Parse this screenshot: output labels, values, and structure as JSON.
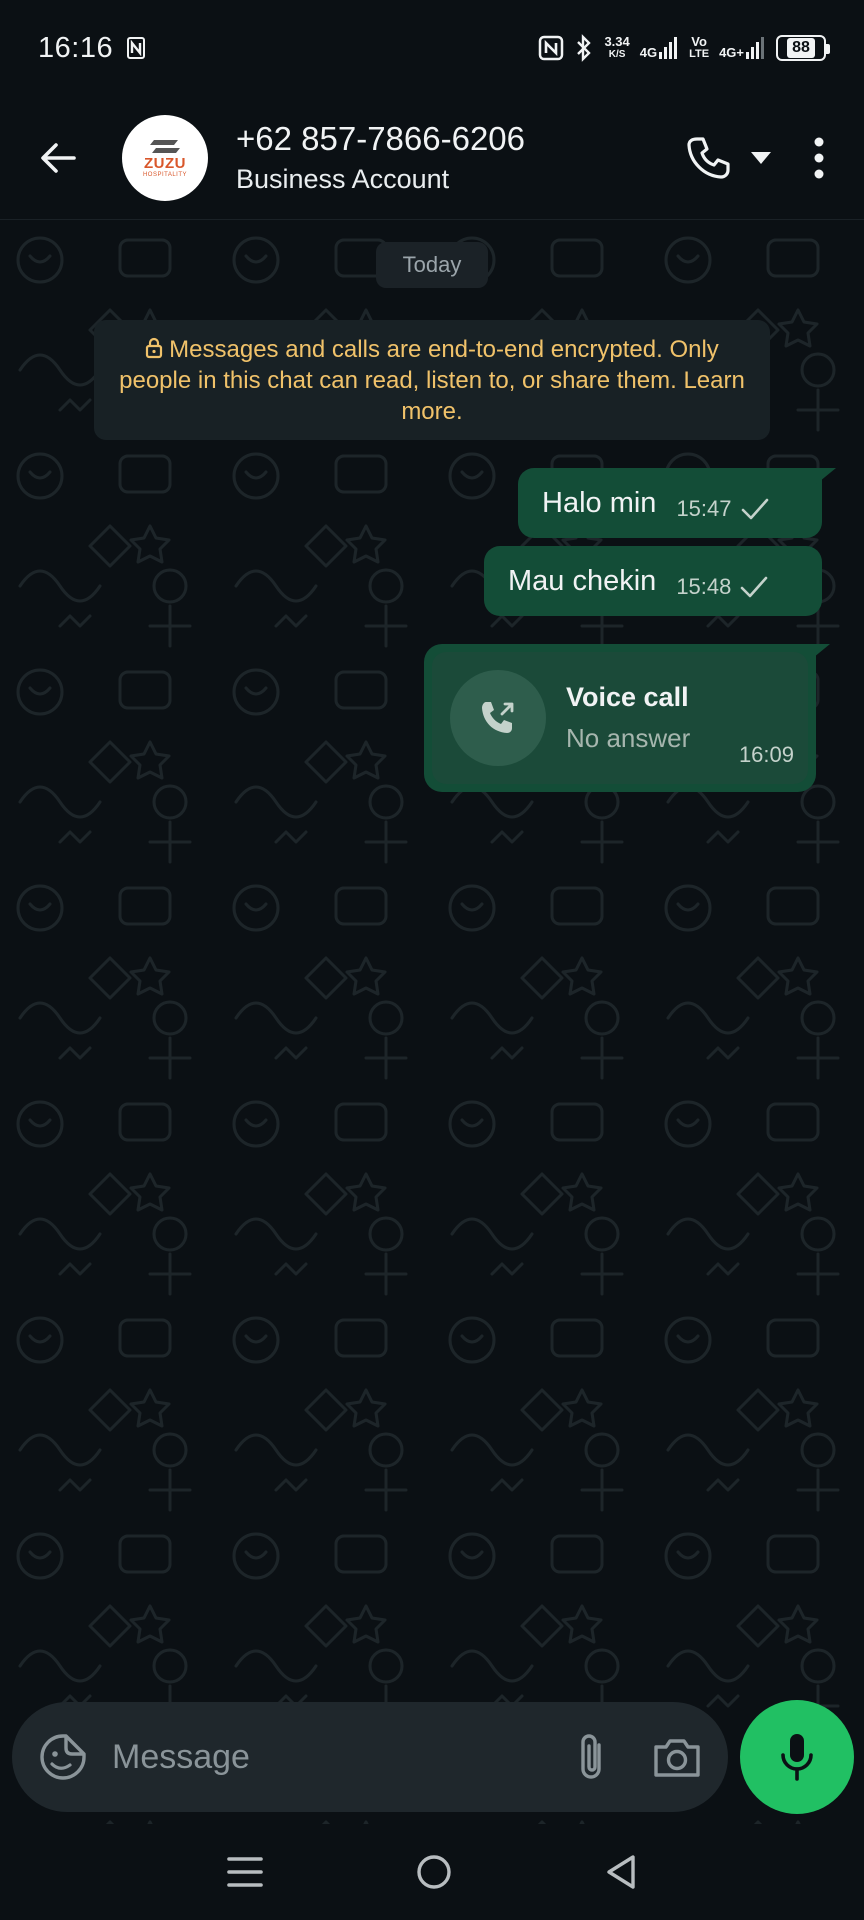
{
  "status_bar": {
    "time": "16:16",
    "net_speed_value": "3.34",
    "net_speed_unit": "K/S",
    "signal1_label": "4G",
    "volte_top": "Vo",
    "volte_bottom": "LTE",
    "signal2_label": "4G+",
    "battery": "88"
  },
  "header": {
    "contact_name": "+62 857-7866-6206",
    "contact_subtitle": "Business Account",
    "avatar_brand": "ZUZU",
    "avatar_brand_sub": "HOSPITALITY"
  },
  "chat": {
    "date_chip": "Today",
    "encryption_notice": "Messages and calls are end-to-end encrypted. Only people in this chat can read, listen to, or share them. Learn more.",
    "messages": [
      {
        "text": "Halo min",
        "time": "15:47",
        "status": "sent"
      },
      {
        "text": "Mau chekin",
        "time": "15:48",
        "status": "sent"
      }
    ],
    "call": {
      "title": "Voice call",
      "status": "No answer",
      "time": "16:09"
    }
  },
  "input": {
    "placeholder": "Message"
  },
  "colors": {
    "background": "#0b1014",
    "bubble_outgoing": "#134d37",
    "accent_green": "#21c063",
    "notice_text": "#f0c26a"
  },
  "icons": {
    "back": "arrow-left-icon",
    "call": "phone-icon",
    "call_menu": "caret-down-icon",
    "menu": "more-vertical-icon",
    "emoji": "sticker-icon",
    "attach": "paperclip-icon",
    "camera": "camera-icon",
    "mic": "mic-icon"
  }
}
